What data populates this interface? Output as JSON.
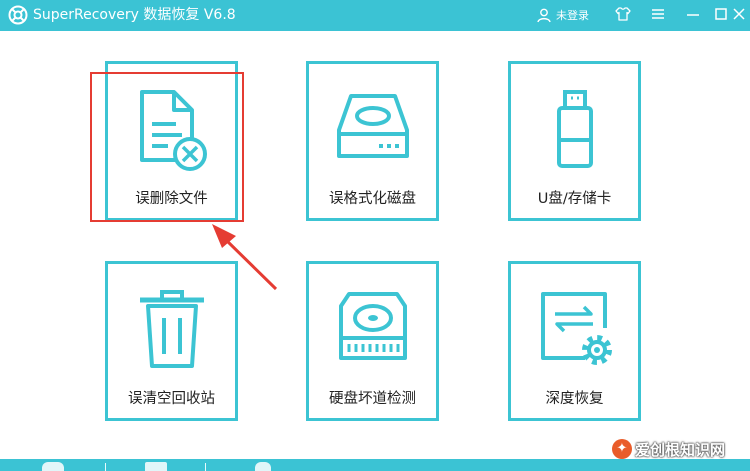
{
  "titlebar": {
    "app_title": "SuperRecovery 数据恢复 V6.8",
    "login_label": "未登录",
    "logo_icon": "lifebuoy-logo-icon",
    "buttons": [
      "shirt-skin-icon",
      "menu-icon",
      "minimize-icon",
      "maximize-icon",
      "close-icon"
    ]
  },
  "cards": [
    {
      "label": "误删除文件",
      "icon": "deleted-document-icon"
    },
    {
      "label": "误格式化磁盘",
      "icon": "hard-drive-icon"
    },
    {
      "label": "U盘/存储卡",
      "icon": "usb-drive-icon"
    },
    {
      "label": "误清空回收站",
      "icon": "trash-bin-icon"
    },
    {
      "label": "硬盘坏道检测",
      "icon": "disk-check-icon"
    },
    {
      "label": "深度恢复",
      "icon": "deep-recovery-icon"
    }
  ],
  "watermark": {
    "text": "爱创根知识网"
  },
  "colors": {
    "accent": "#3bc3d4",
    "highlight": "#e53c33"
  }
}
